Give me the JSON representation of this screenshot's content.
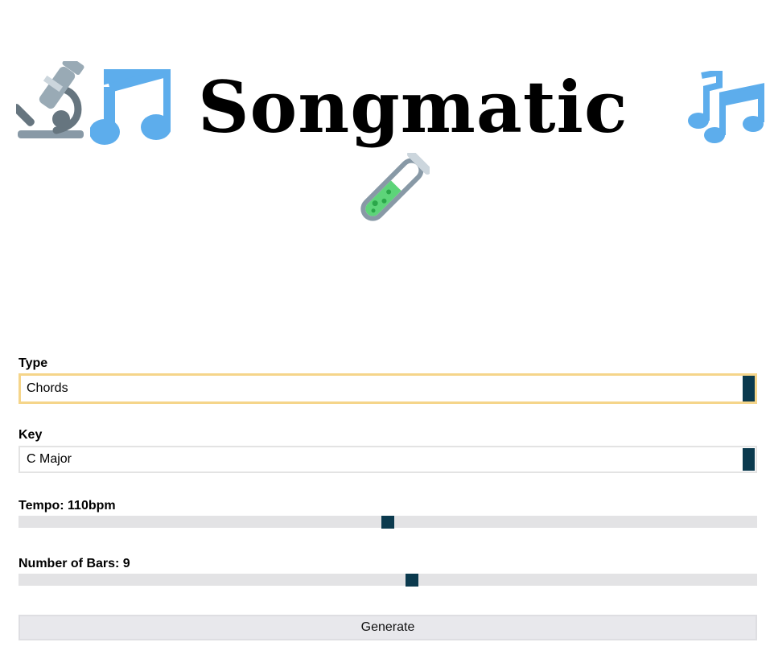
{
  "header": {
    "title": "Songmatic",
    "icons": [
      "microscope-icon",
      "musical-note-icon",
      "musical-notes-icon",
      "test-tube-icon"
    ]
  },
  "form": {
    "type": {
      "label": "Type",
      "value": "Chords"
    },
    "key": {
      "label": "Key",
      "value": "C Major"
    },
    "tempo": {
      "label": "Tempo: 110bpm",
      "fraction": 0.5
    },
    "bars": {
      "label": "Number of Bars: 9",
      "fraction": 0.533
    },
    "generate_label": "Generate"
  },
  "colors": {
    "accent": "#0b3a4e",
    "focus": "#f5d58a",
    "track": "#e3e3e5",
    "note_blue": "#5dadec"
  }
}
